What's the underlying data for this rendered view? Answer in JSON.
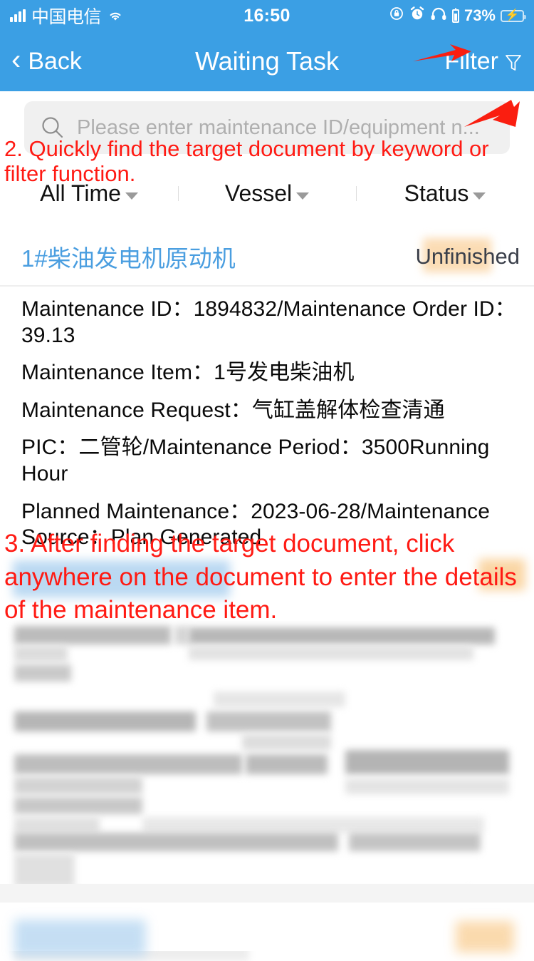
{
  "status_bar": {
    "carrier": "中国电信",
    "time": "16:50",
    "battery_percent": "73%",
    "icons": [
      "signal-icon",
      "wifi-icon",
      "rotation-lock-icon",
      "alarm-clock-icon",
      "headphones-icon",
      "headphone-battery-icon",
      "battery-charging-icon"
    ]
  },
  "nav": {
    "back_label": "Back",
    "title": "Waiting Task",
    "filter_label": "Filter",
    "filter_icon": "funnel-icon",
    "back_icon": "chevron-left-icon"
  },
  "search": {
    "placeholder": "Please enter maintenance ID/equipment n...",
    "value": "",
    "icon": "search-icon"
  },
  "filters": [
    {
      "label": "All Time",
      "icon": "chevron-down-icon"
    },
    {
      "label": "Vessel",
      "icon": "chevron-down-icon"
    },
    {
      "label": "Status",
      "icon": "chevron-down-icon"
    }
  ],
  "card": {
    "title": "1#柴油发电机原动机",
    "status": "Unfinished",
    "rows": [
      "Maintenance ID：1894832/Maintenance Order ID：39.13",
      "Maintenance Item：1号发电柴油机",
      "Maintenance Request：气缸盖解体检查清通",
      "PIC：二管轮/Maintenance Period：3500Running Hour",
      "Planned Maintenance：2023-06-28/Maintenance Source：Plan Generated"
    ]
  },
  "annotations": [
    {
      "id": "step-2",
      "text": "2. Quickly find the target document by keyword or filter function."
    },
    {
      "id": "step-3",
      "text": "3. After finding the target document, click anywhere on the document to enter the details of the maintenance item."
    }
  ],
  "colors": {
    "header_blue": "#3B9FE4",
    "link_blue": "#4A9EE0",
    "annotation_red": "#FF1A13",
    "status_highlight": "#FBDCB4",
    "battery_green": "#4CD763",
    "search_bg": "#F0F0F0"
  }
}
